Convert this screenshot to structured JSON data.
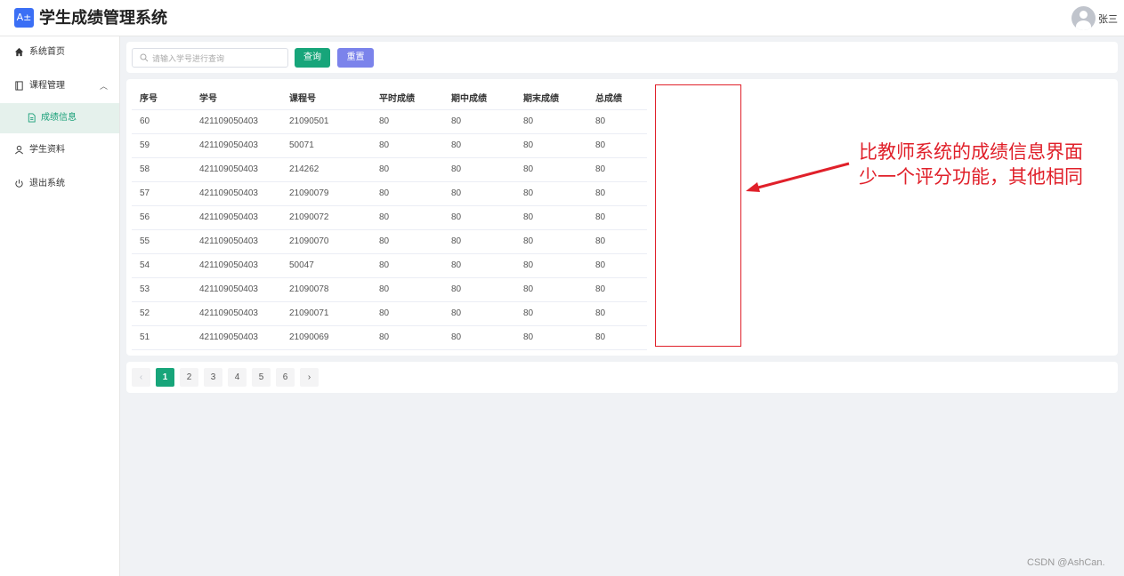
{
  "header": {
    "logo_text": "A±",
    "title": "学生成绩管理系统",
    "user_name": "张三"
  },
  "sidebar": {
    "items": [
      {
        "label": "系统首页",
        "icon": "home-icon"
      },
      {
        "label": "课程管理",
        "icon": "book-icon",
        "expanded": true
      },
      {
        "label": "成绩信息",
        "icon": "document-icon",
        "active": true
      },
      {
        "label": "学生资料",
        "icon": "user-icon"
      },
      {
        "label": "退出系统",
        "icon": "power-icon"
      }
    ]
  },
  "search": {
    "placeholder": "请输入学号进行查询",
    "value": "",
    "query_label": "查询",
    "reset_label": "重置"
  },
  "table": {
    "columns": [
      "序号",
      "学号",
      "课程号",
      "平时成绩",
      "期中成绩",
      "期末成绩",
      "总成绩"
    ],
    "rows": [
      [
        "60",
        "421109050403",
        "21090501",
        "80",
        "80",
        "80",
        "80"
      ],
      [
        "59",
        "421109050403",
        "50071",
        "80",
        "80",
        "80",
        "80"
      ],
      [
        "58",
        "421109050403",
        "214262",
        "80",
        "80",
        "80",
        "80"
      ],
      [
        "57",
        "421109050403",
        "21090079",
        "80",
        "80",
        "80",
        "80"
      ],
      [
        "56",
        "421109050403",
        "21090072",
        "80",
        "80",
        "80",
        "80"
      ],
      [
        "55",
        "421109050403",
        "21090070",
        "80",
        "80",
        "80",
        "80"
      ],
      [
        "54",
        "421109050403",
        "50047",
        "80",
        "80",
        "80",
        "80"
      ],
      [
        "53",
        "421109050403",
        "21090078",
        "80",
        "80",
        "80",
        "80"
      ],
      [
        "52",
        "421109050403",
        "21090071",
        "80",
        "80",
        "80",
        "80"
      ],
      [
        "51",
        "421109050403",
        "21090069",
        "80",
        "80",
        "80",
        "80"
      ]
    ]
  },
  "annotation": {
    "line1": "比教师系统的成绩信息界面",
    "line2": "少一个评分功能，其他相同",
    "color": "#e0202a"
  },
  "pagination": {
    "prev": "‹",
    "next": "›",
    "pages": [
      "1",
      "2",
      "3",
      "4",
      "5",
      "6"
    ],
    "current": "1"
  },
  "watermark": "CSDN @AshCan.",
  "colors": {
    "accent": "#17a57a",
    "reset_button": "#7b83eb",
    "logo": "#3b6ff5"
  }
}
